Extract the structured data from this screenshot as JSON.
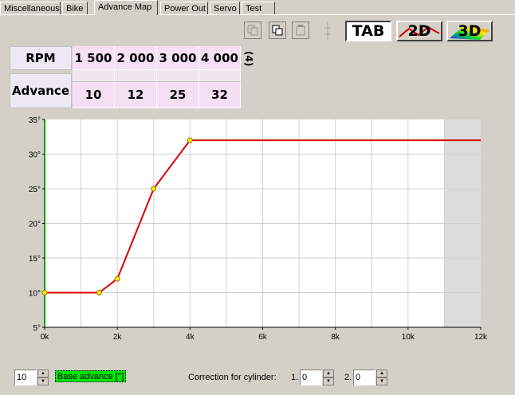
{
  "tabs": [
    {
      "label": "Miscellaneous",
      "active": false
    },
    {
      "label": "Bike",
      "active": false
    },
    {
      "label": "Advance Map",
      "active": true
    },
    {
      "label": "Power Out",
      "active": false
    },
    {
      "label": "Servo",
      "active": false
    },
    {
      "label": "Test",
      "active": false
    }
  ],
  "toolbar": {
    "view_tab_label": "TAB",
    "view_2d_label": "2D",
    "view_3d_label": "3D"
  },
  "table": {
    "row1_header": "RPM",
    "row2_header": "Advance",
    "rpm": [
      "1 500",
      "2 000",
      "3 000",
      "4 000"
    ],
    "advance": [
      "10",
      "12",
      "25",
      "32"
    ],
    "count_label": "(4)"
  },
  "chart_data": {
    "type": "line",
    "x": [
      0,
      1500,
      2000,
      3000,
      4000,
      12000
    ],
    "y": [
      10,
      10,
      12,
      25,
      32,
      32
    ],
    "marker_points": [
      [
        0,
        10
      ],
      [
        1500,
        10
      ],
      [
        2000,
        12
      ],
      [
        3000,
        25
      ],
      [
        4000,
        32
      ]
    ],
    "xlim": [
      0,
      12000
    ],
    "ylim": [
      5,
      35
    ],
    "x_ticks": [
      0,
      2000,
      4000,
      6000,
      8000,
      10000,
      12000
    ],
    "x_tick_labels": [
      "0k",
      "2k",
      "4k",
      "6k",
      "8k",
      "10k",
      "12k"
    ],
    "y_ticks": [
      5,
      10,
      15,
      20,
      25,
      30,
      35
    ],
    "y_tick_labels": [
      "5°",
      "10°",
      "15°",
      "20°",
      "25°",
      "30°",
      "35°"
    ],
    "shaded_from_x": 11000,
    "grid": true,
    "line_color": "#dd0000",
    "marker_color": "#ffee00"
  },
  "bottom": {
    "base_value": "10",
    "base_label": "Base advance [°]",
    "correction_label": "Correction for cylinder:",
    "cyl1_label": "1.",
    "cyl1_value": "0",
    "cyl2_label": "2.",
    "cyl2_value": "0"
  }
}
